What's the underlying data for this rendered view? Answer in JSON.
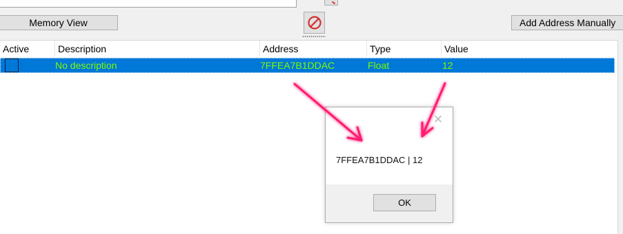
{
  "toolbar": {
    "memory_view_label": "Memory View",
    "add_address_label": "Add Address Manually",
    "clear_icon": "no-entry-icon"
  },
  "columns": [
    {
      "label": "Active"
    },
    {
      "label": "Description"
    },
    {
      "label": "Address"
    },
    {
      "label": "Type"
    },
    {
      "label": "Value"
    }
  ],
  "rows": [
    {
      "active": false,
      "description": "No description",
      "address": "7FFEA7B1DDAC",
      "type": "Float",
      "value": "12"
    }
  ],
  "dialog": {
    "message": "7FFEA7B1DDAC | 12",
    "ok_label": "OK",
    "close_icon": "close-icon"
  },
  "colors": {
    "selection": "#0078d7",
    "row_text": "#7cfc00",
    "arrow": "#ff1a70",
    "clear_icon": "#d32f2f"
  }
}
